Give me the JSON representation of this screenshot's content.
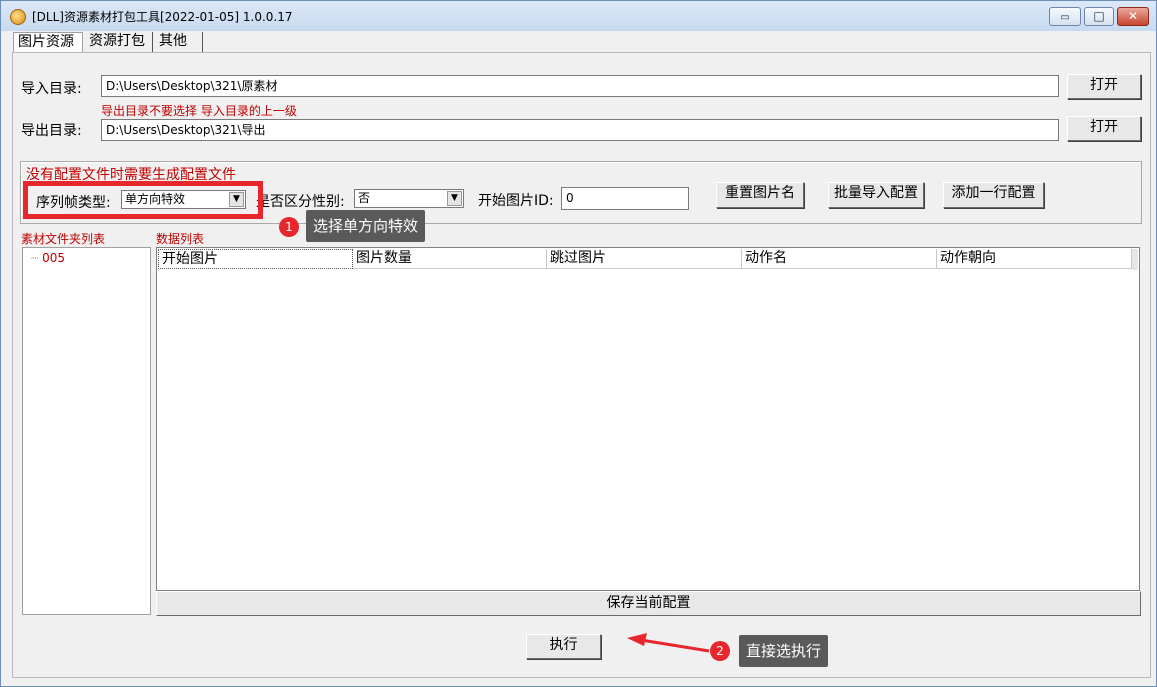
{
  "window": {
    "title": "[DLL]资源素材打包工具[2022-01-05] 1.0.0.17",
    "minimize": "▭",
    "maximize": "□",
    "close": "✕"
  },
  "tabs": [
    "图片资源",
    "资源打包",
    "其他"
  ],
  "import": {
    "label": "导入目录:",
    "value": "D:\\Users\\Desktop\\321\\原素材",
    "button": "打开"
  },
  "hint": "导出目录不要选择 导入目录的上一级",
  "export": {
    "label": "导出目录:",
    "value": "D:\\Users\\Desktop\\321\\导出",
    "button": "打开"
  },
  "config": {
    "notice": "没有配置文件时需要生成配置文件",
    "sequence_label": "序列帧类型:",
    "sequence_value": "单方向特效",
    "gender_label": "是否区分性别:",
    "gender_value": "否",
    "start_id_label": "开始图片ID:",
    "start_id_value": "0",
    "reset_button": "重置图片名",
    "batch_button": "批量导入配置",
    "add_row_button": "添加一行配置"
  },
  "material_list": {
    "title": "素材文件夹列表",
    "items": [
      "005"
    ]
  },
  "data_list": {
    "title": "数据列表",
    "columns": [
      "开始图片",
      "图片数量",
      "跳过图片",
      "动作名",
      "动作朝向"
    ]
  },
  "save_button": "保存当前配置",
  "execute_button": "执行",
  "annotations": {
    "step1_number": "1",
    "step1_text": "选择单方向特效",
    "step2_number": "2",
    "step2_text": "直接选执行",
    "highlight_color": "#e8262d"
  }
}
